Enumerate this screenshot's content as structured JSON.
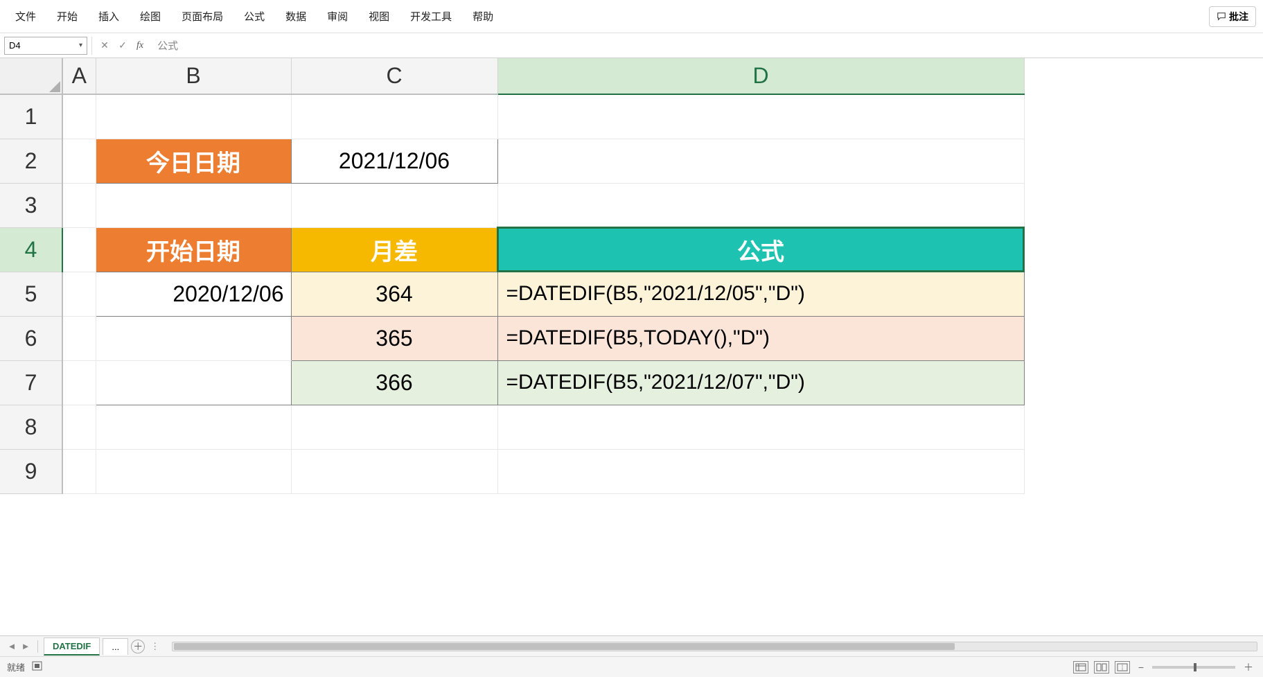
{
  "menu": {
    "items": [
      "文件",
      "开始",
      "插入",
      "绘图",
      "页面布局",
      "公式",
      "数据",
      "审阅",
      "视图",
      "开发工具",
      "帮助"
    ],
    "comment_label": "批注"
  },
  "formula_bar": {
    "name_box": "D4",
    "formula_value": "公式"
  },
  "columns": [
    "A",
    "B",
    "C",
    "D"
  ],
  "rows": [
    "1",
    "2",
    "3",
    "4",
    "5",
    "6",
    "7",
    "8",
    "9"
  ],
  "cells": {
    "B2": "今日日期",
    "C2": "2021/12/06",
    "B4": "开始日期",
    "C4": "月差",
    "D4": "公式",
    "B5": "2020/12/06",
    "C5": "364",
    "D5": "=DATEDIF(B5,\"2021/12/05\",\"D\")",
    "C6": "365",
    "D6": "=DATEDIF(B5,TODAY(),\"D\")",
    "C7": "366",
    "D7": "=DATEDIF(B5,\"2021/12/07\",\"D\")"
  },
  "sheet_tabs": {
    "active": "DATEDIF",
    "more": "..."
  },
  "status": {
    "ready": "就绪"
  },
  "selected_cell": "D4"
}
